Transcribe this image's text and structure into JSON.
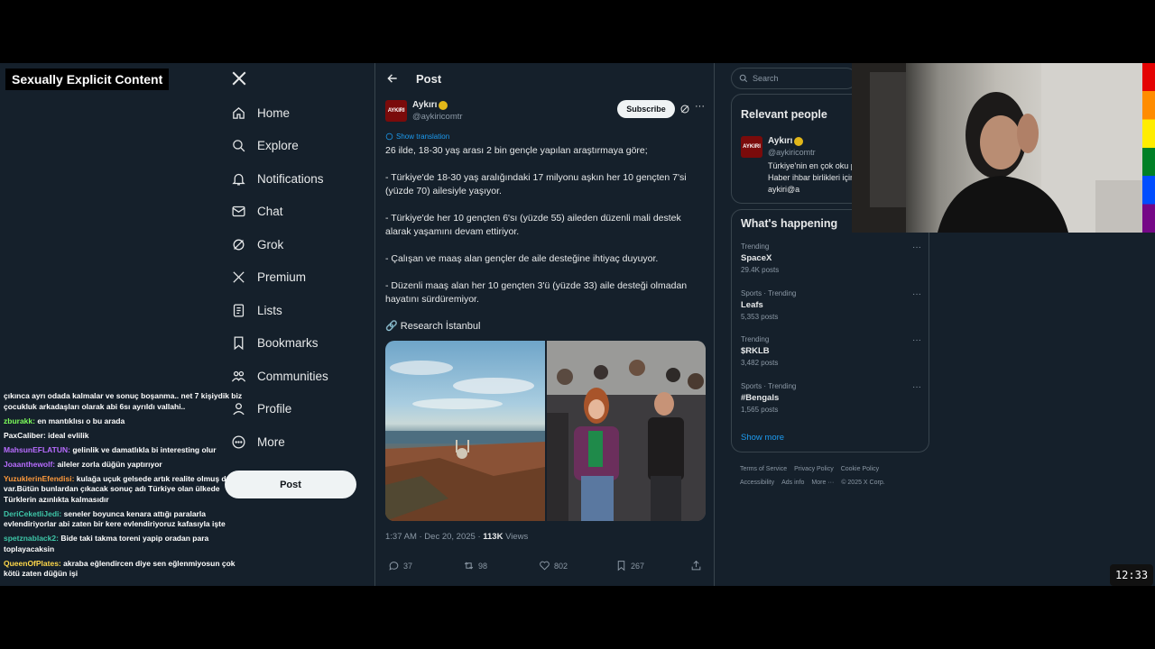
{
  "overlay": {
    "title": "Sexually Explicit Content"
  },
  "chat": [
    {
      "user": "",
      "text": "çıkınca ayrı odada kalmalar ve sonuç boşanma.. net 7 kişiydik biz çocukluk arkadaşları olarak abi 6sı ayrıldı vallahi..",
      "color": "#ffffff"
    },
    {
      "user": "zburakk:",
      "text": "en mantıklısı o bu arada",
      "color": "#7cfc5a"
    },
    {
      "user": "PaxCaliber:",
      "text": "ideal evlilik",
      "color": "#ffffff"
    },
    {
      "user": "MahsunEFLATUN:",
      "text": "gelinlik ve damatlıkla bi interesting olur",
      "color": "#b86cff"
    },
    {
      "user": "Joaanthewolf:",
      "text": "aileler zorla düğün yaptırıyor",
      "color": "#b86cff"
    },
    {
      "user": "YuzuklerinEfendisi:",
      "text": "kulağa uçuk gelsede artık realite olmuş durum var.Bütün bunlardan çıkacak sonuç adı Türkiye olan ülkede Türklerin azınlıkta kalmasıdır",
      "color": "#ff9a3c"
    },
    {
      "user": "DeriCeketliJedi:",
      "text": "seneler boyunca kenara attığı paralarla evlendiriyorlar abi zaten bir kere evlendiriyoruz kafasıyla işte",
      "color": "#3ec6a8"
    },
    {
      "user": "spetznablack2:",
      "text": "Bide taki takma toreni yapip oradan para toplayacaksin",
      "color": "#3ec6a8"
    },
    {
      "user": "QueenOfPlates:",
      "text": "akraba eğlendircen diye sen eğlenmiyosun çok kötü zaten düğün işi",
      "color": "#ffd84a"
    }
  ],
  "nav": {
    "items": [
      {
        "label": "Home",
        "icon": "home-icon"
      },
      {
        "label": "Explore",
        "icon": "search-icon"
      },
      {
        "label": "Notifications",
        "icon": "bell-icon"
      },
      {
        "label": "Chat",
        "icon": "mail-icon"
      },
      {
        "label": "Grok",
        "icon": "grok-icon"
      },
      {
        "label": "Premium",
        "icon": "x-icon"
      },
      {
        "label": "Lists",
        "icon": "list-icon"
      },
      {
        "label": "Bookmarks",
        "icon": "bookmark-icon"
      },
      {
        "label": "Communities",
        "icon": "people-icon"
      },
      {
        "label": "Profile",
        "icon": "person-icon"
      },
      {
        "label": "More",
        "icon": "more-circle-icon"
      }
    ],
    "post_button": "Post"
  },
  "post": {
    "header": "Post",
    "author_avatar_text": "AYKIRI",
    "author_name": "Aykırı",
    "author_handle": "@aykiricomtr",
    "subscribe": "Subscribe",
    "show_translation": "Show translation",
    "paragraphs": [
      "26 ilde, 18-30 yaş arası 2 bin gençle yapılan araştırmaya göre;",
      "- Türkiye'de 18-30 yaş aralığındaki 17 milyonu aşkın her 10 gençten 7'si (yüzde 70) ailesiyle yaşıyor.",
      "- Türkiye'de her 10 gençten 6'sı (yüzde 55) aileden düzenli mali destek alarak yaşamını devam ettiriyor.",
      "- Çalışan ve maaş alan gençler de aile desteğine ihtiyaç duyuyor.",
      "- Düzenli maaş alan her 10 gençten 3'ü (yüzde 33) aile desteği olmadan hayatını sürdüremiyor."
    ],
    "link_text": "🔗 Research İstanbul",
    "time": "1:37 AM · Dec 20, 2025 · ",
    "views_count": "113K",
    "views_label": " Views",
    "actions": {
      "replies": "37",
      "reposts": "98",
      "likes": "802",
      "bookmarks": "267"
    }
  },
  "sidebar": {
    "search_placeholder": "Search",
    "relevant_title": "Relevant people",
    "relevant_person": {
      "avatar_text": "AYKIRI",
      "name": "Aykırı",
      "handle": "@aykiricomtr",
      "bio": "Türkiye'nin en çok oku platformu Haber ihbar birlikleri için: aykiri@a"
    },
    "happening_title": "What's happening",
    "trends": [
      {
        "category": "Trending",
        "name": "SpaceX",
        "count": "29.4K posts"
      },
      {
        "category": "Sports · Trending",
        "name": "Leafs",
        "count": "5,353 posts"
      },
      {
        "category": "Trending",
        "name": "$RKLB",
        "count": "3,482 posts"
      },
      {
        "category": "Sports · Trending",
        "name": "#Bengals",
        "count": "1,565 posts"
      }
    ],
    "show_more": "Show more",
    "footer": [
      "Terms of Service",
      "Privacy Policy",
      "Cookie Policy",
      "Accessibility",
      "Ads info",
      "More ···",
      "© 2025 X Corp."
    ]
  },
  "clock": "12:33"
}
